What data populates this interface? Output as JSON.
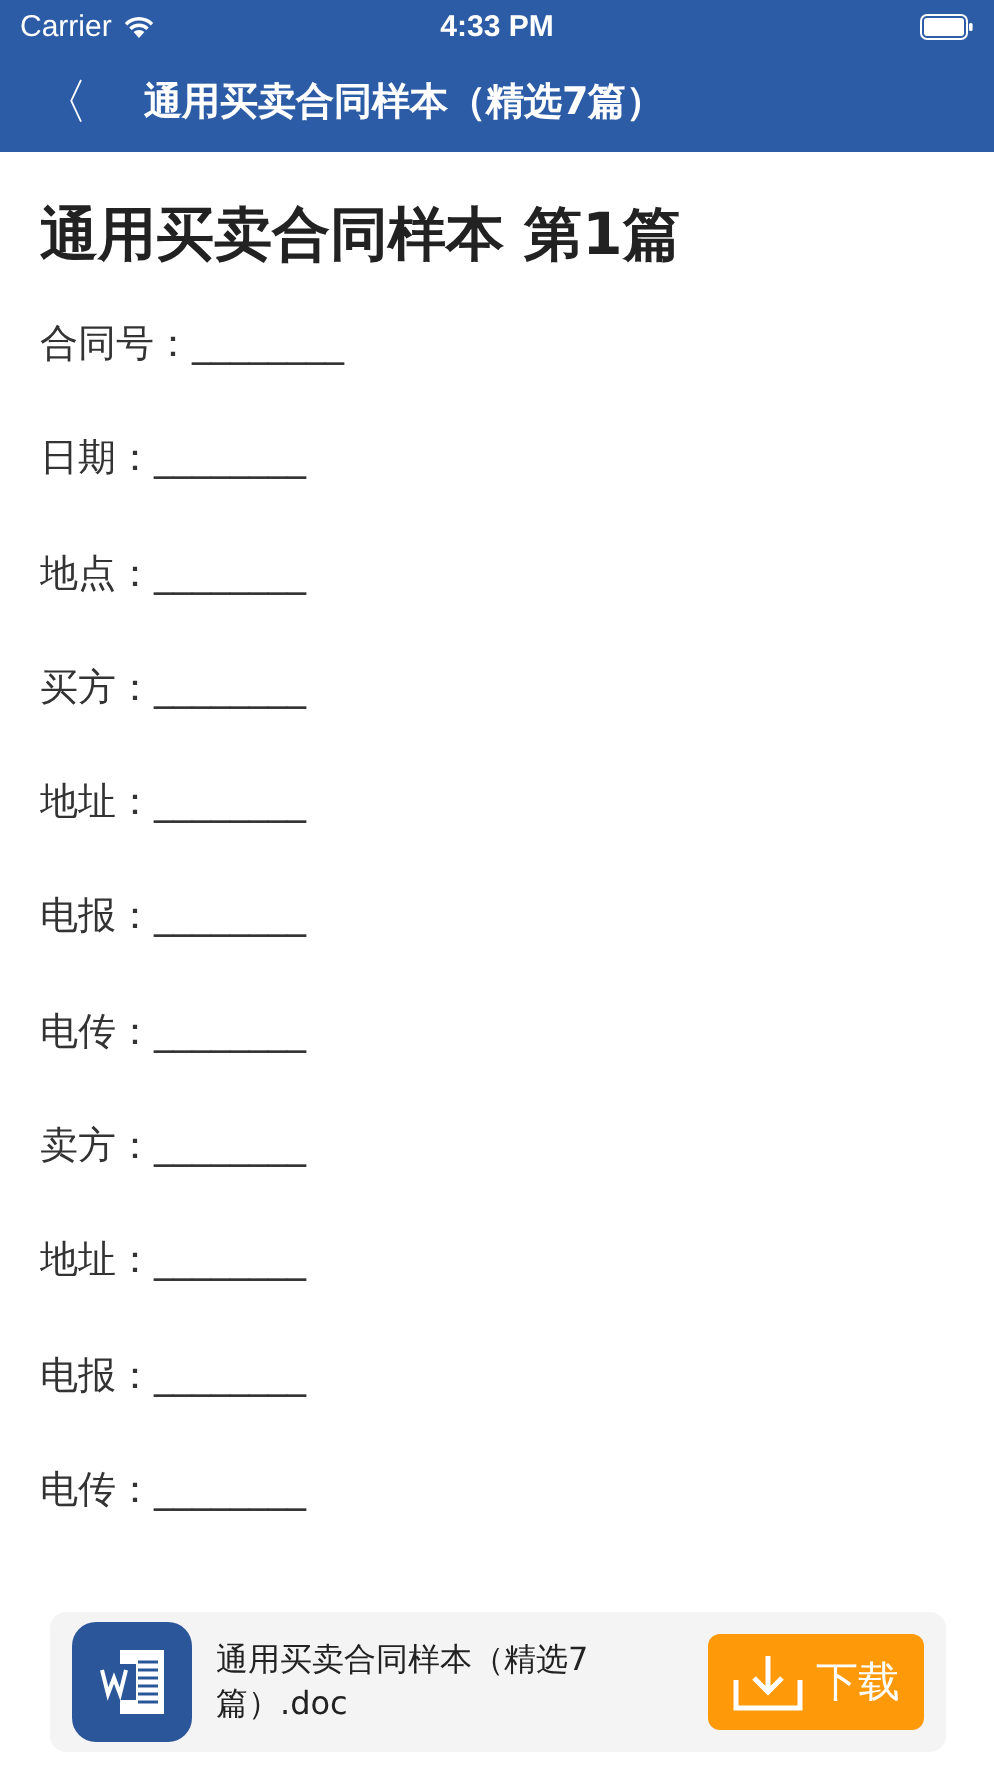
{
  "status_bar": {
    "carrier": "Carrier",
    "time": "4:33 PM"
  },
  "nav_bar": {
    "back": "〈",
    "title": "通用买卖合同样本（精选7篇）"
  },
  "document": {
    "heading": "通用买卖合同样本 第1篇",
    "fields": [
      {
        "label": "合同号：",
        "blank": "________"
      },
      {
        "label": "日期：",
        "blank": "________"
      },
      {
        "label": "地点：",
        "blank": "________"
      },
      {
        "label": "买方：",
        "blank": "________"
      },
      {
        "label": "地址：",
        "blank": "________"
      },
      {
        "label": "电报：",
        "blank": "________"
      },
      {
        "label": "电传：",
        "blank": "________"
      },
      {
        "label": "卖方：",
        "blank": "________"
      },
      {
        "label": "地址：",
        "blank": "________"
      },
      {
        "label": "电报：",
        "blank": "________"
      },
      {
        "label": "电传：",
        "blank": "________"
      }
    ]
  },
  "download_banner": {
    "file_name": "通用买卖合同样本（精选7篇）.doc",
    "button": "下载"
  }
}
